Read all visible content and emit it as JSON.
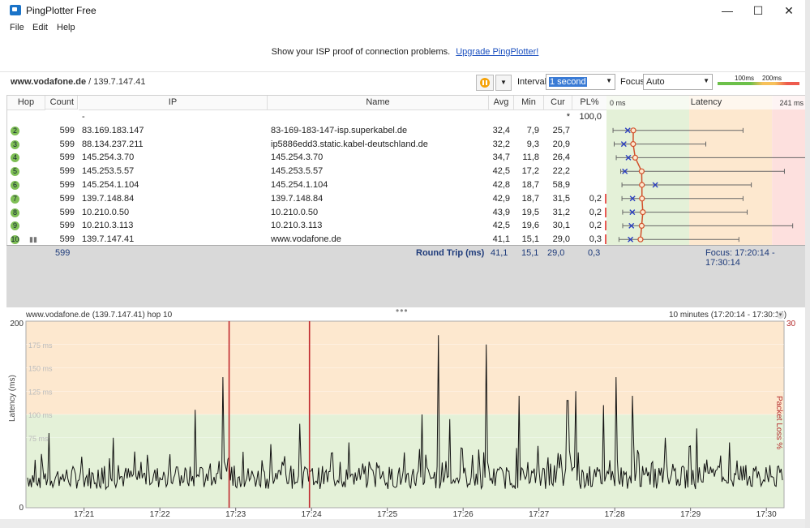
{
  "window": {
    "title": "PingPlotter Free",
    "minimize": "—",
    "maximize": "☐",
    "close": "✕"
  },
  "menu": [
    "File",
    "Edit",
    "Help"
  ],
  "banner": {
    "text": "Show your ISP proof of connection problems.",
    "link": "Upgrade PingPlotter!"
  },
  "target": {
    "host": "www.vodafone.de",
    "ip": " / 139.7.147.41"
  },
  "controls": {
    "interval_label": "Interval",
    "interval_value": "1 second",
    "focus_label": "Focus",
    "focus_value": "Auto",
    "legend_100": "100ms",
    "legend_200": "200ms"
  },
  "table": {
    "columns": [
      "Hop",
      "Count",
      "IP",
      "Name",
      "Avg",
      "Min",
      "Cur",
      "PL%"
    ],
    "latency_header": "Latency",
    "latency_min": "0 ms",
    "latency_max": "241 ms",
    "rows": [
      {
        "hop": "",
        "count": "",
        "ip": "-",
        "name": "",
        "avg": "",
        "min": "",
        "cur": "*",
        "pl": "100,0",
        "avgv": null,
        "minv": null,
        "maxv": null,
        "curv": null
      },
      {
        "hop": "2",
        "count": "599",
        "ip": "83.169.183.147",
        "name": "83-169-183-147-isp.superkabel.de",
        "avg": "32,4",
        "min": "7,9",
        "cur": "25,7",
        "pl": "",
        "avgv": 32.4,
        "minv": 7.9,
        "maxv": 165,
        "curv": 25.7
      },
      {
        "hop": "3",
        "count": "599",
        "ip": "88.134.237.211",
        "name": "ip5886edd3.static.kabel-deutschland.de",
        "avg": "32,2",
        "min": "9,3",
        "cur": "20,9",
        "pl": "",
        "avgv": 32.2,
        "minv": 9.3,
        "maxv": 120,
        "curv": 20.9
      },
      {
        "hop": "4",
        "count": "599",
        "ip": "145.254.3.70",
        "name": "145.254.3.70",
        "avg": "34,7",
        "min": "11,8",
        "cur": "26,4",
        "pl": "",
        "avgv": 34.7,
        "minv": 11.8,
        "maxv": 241,
        "curv": 26.4
      },
      {
        "hop": "5",
        "count": "599",
        "ip": "145.253.5.57",
        "name": "145.253.5.57",
        "avg": "42,5",
        "min": "17,2",
        "cur": "22,2",
        "pl": "",
        "avgv": 42.5,
        "minv": 17.2,
        "maxv": 215,
        "curv": 22.2
      },
      {
        "hop": "6",
        "count": "599",
        "ip": "145.254.1.104",
        "name": "145.254.1.104",
        "avg": "42,8",
        "min": "18,7",
        "cur": "58,9",
        "pl": "",
        "avgv": 42.8,
        "minv": 18.7,
        "maxv": 175,
        "curv": 58.9
      },
      {
        "hop": "7",
        "count": "599",
        "ip": "139.7.148.84",
        "name": "139.7.148.84",
        "avg": "42,9",
        "min": "18,7",
        "cur": "31,5",
        "pl": "0,2",
        "avgv": 42.9,
        "minv": 18.7,
        "maxv": 165,
        "curv": 31.5
      },
      {
        "hop": "8",
        "count": "599",
        "ip": "10.210.0.50",
        "name": "10.210.0.50",
        "avg": "43,9",
        "min": "19,5",
        "cur": "31,2",
        "pl": "0,2",
        "avgv": 43.9,
        "minv": 19.5,
        "maxv": 170,
        "curv": 31.2
      },
      {
        "hop": "9",
        "count": "599",
        "ip": "10.210.3.113",
        "name": "10.210.3.113",
        "avg": "42,5",
        "min": "19,6",
        "cur": "30,1",
        "pl": "0,2",
        "avgv": 42.5,
        "minv": 19.6,
        "maxv": 225,
        "curv": 30.1
      },
      {
        "hop": "10",
        "count": "599",
        "ip": "139.7.147.41",
        "name": "www.vodafone.de",
        "avg": "41,1",
        "min": "15,1",
        "cur": "29,0",
        "pl": "0,3",
        "avgv": 41.1,
        "minv": 15.1,
        "maxv": 160,
        "curv": 29.0
      }
    ],
    "summary": {
      "count": "599",
      "label": "Round Trip (ms)",
      "avg": "41,1",
      "min": "15,1",
      "cur": "29,0",
      "pl": "0,3",
      "focus": "Focus: 17:20:14 - 17:30:14"
    }
  },
  "graph": {
    "title": "www.vodafone.de (139.7.147.41) hop 10",
    "range": "10 minutes (17:20:14 - 17:30:14)",
    "y_label": "Latency (ms)",
    "y2_label": "Packet Loss %",
    "y_ticks": [
      "200",
      "0"
    ],
    "y2_tick": "30",
    "gridlines": [
      "175 ms",
      "150 ms",
      "125 ms",
      "100 ms",
      "75 ms"
    ],
    "x_ticks": [
      "17:21",
      "17:22",
      "17:23",
      "17:24",
      "17:25",
      "17:26",
      "17:27",
      "17:28",
      "17:29",
      "17:30"
    ],
    "loss_markers_min": [
      2.68,
      3.74
    ],
    "colors": {
      "green": "#e4f1d8",
      "orange": "#fde8cf",
      "red": "#fde0de",
      "line": "#111111",
      "loss": "#c0282d"
    }
  }
}
